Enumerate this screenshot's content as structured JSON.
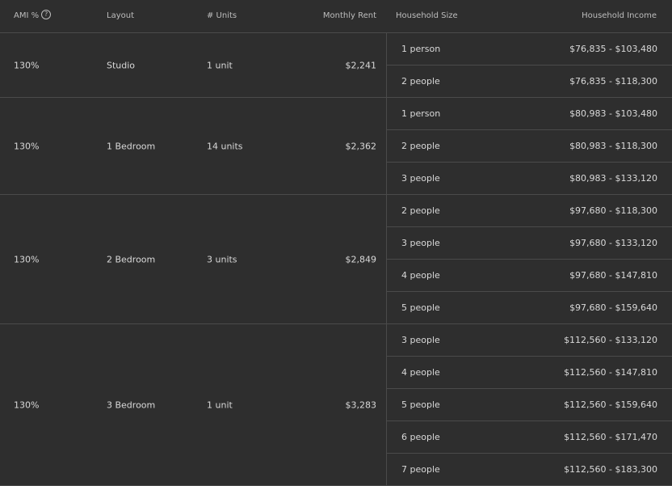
{
  "header": {
    "ami": "AMI %",
    "help_glyph": "?",
    "layout": "Layout",
    "units": "# Units",
    "rent": "Monthly Rent",
    "household_size": "Household Size",
    "household_income": "Household Income"
  },
  "groups": [
    {
      "ami": "130%",
      "layout": "Studio",
      "units": "1 unit",
      "rent": "$2,241",
      "rows": [
        {
          "size": "1 person",
          "income": "$76,835 - $103,480"
        },
        {
          "size": "2 people",
          "income": "$76,835 - $118,300"
        }
      ]
    },
    {
      "ami": "130%",
      "layout": "1 Bedroom",
      "units": "14 units",
      "rent": "$2,362",
      "rows": [
        {
          "size": "1 person",
          "income": "$80,983 - $103,480"
        },
        {
          "size": "2 people",
          "income": "$80,983 - $118,300"
        },
        {
          "size": "3 people",
          "income": "$80,983 - $133,120"
        }
      ]
    },
    {
      "ami": "130%",
      "layout": "2 Bedroom",
      "units": "3 units",
      "rent": "$2,849",
      "rows": [
        {
          "size": "2 people",
          "income": "$97,680 - $118,300"
        },
        {
          "size": "3 people",
          "income": "$97,680 - $133,120"
        },
        {
          "size": "4 people",
          "income": "$97,680 - $147,810"
        },
        {
          "size": "5 people",
          "income": "$97,680 - $159,640"
        }
      ]
    },
    {
      "ami": "130%",
      "layout": "3 Bedroom",
      "units": "1 unit",
      "rent": "$3,283",
      "rows": [
        {
          "size": "3 people",
          "income": "$112,560 - $133,120"
        },
        {
          "size": "4 people",
          "income": "$112,560 - $147,810"
        },
        {
          "size": "5 people",
          "income": "$112,560 - $159,640"
        },
        {
          "size": "6 people",
          "income": "$112,560 - $171,470"
        },
        {
          "size": "7 people",
          "income": "$112,560 - $183,300"
        }
      ]
    }
  ]
}
